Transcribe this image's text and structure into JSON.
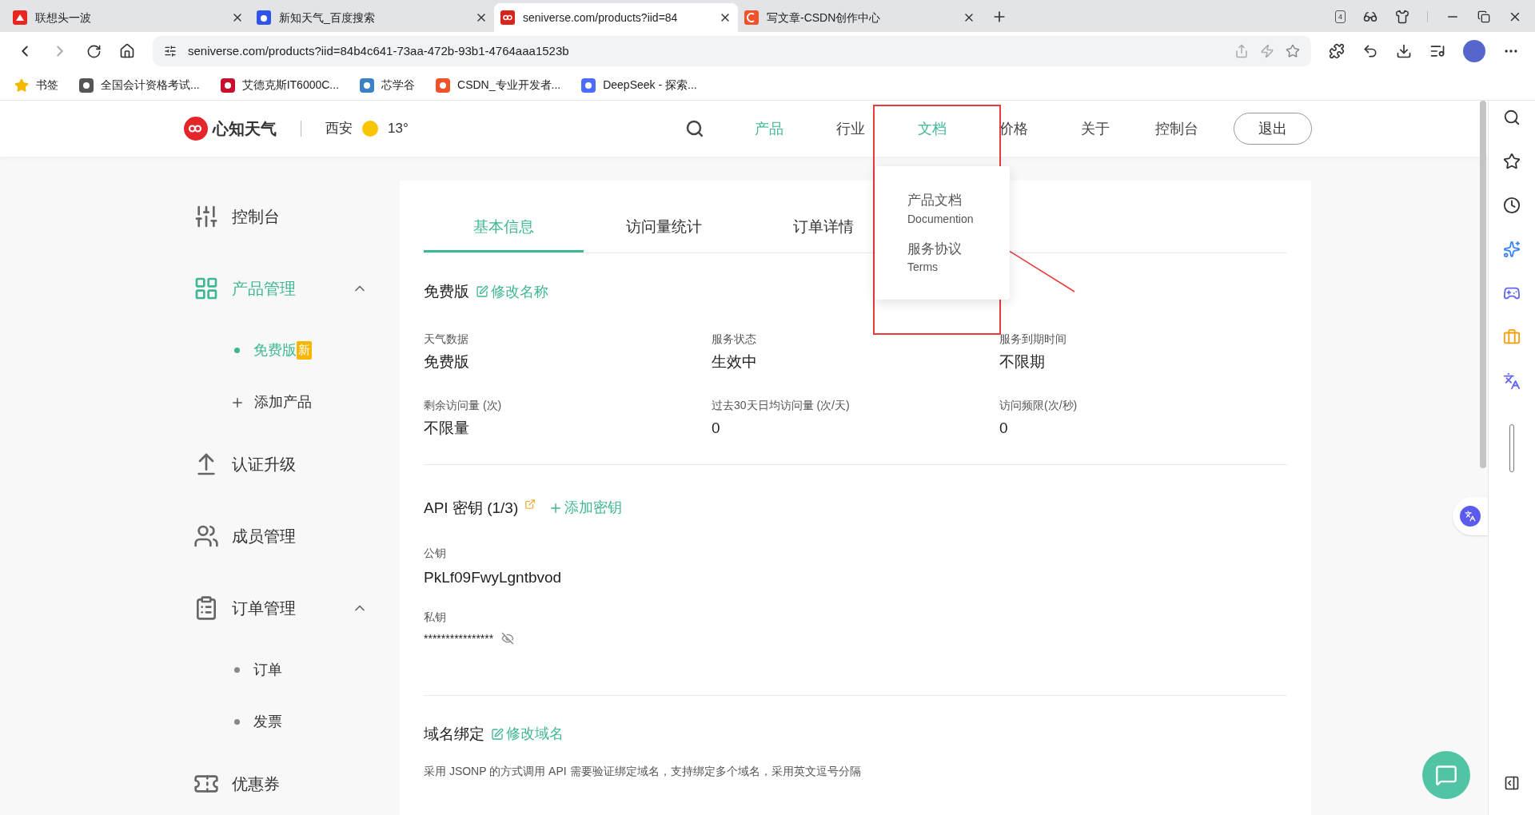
{
  "browser": {
    "tabs": [
      {
        "title": "联想头一波",
        "selected": false
      },
      {
        "title": "新知天气_百度搜索",
        "selected": false
      },
      {
        "title": "seniverse.com/products?iid=84",
        "selected": true
      },
      {
        "title": "写文章-CSDN创作中心",
        "selected": false
      }
    ],
    "tab_count": "4",
    "address": "seniverse.com/products?iid=84b4c641-73aa-472b-93b1-4764aaa1523b",
    "bookmarks": [
      "书签",
      "全国会计资格考试...",
      "艾德克斯IT6000C...",
      "芯学谷",
      "CSDN_专业开发者...",
      "DeepSeek - 探索..."
    ]
  },
  "site": {
    "logo_text": "心知天气",
    "city": "西安",
    "temperature": "13°",
    "nav": [
      {
        "label": "产品",
        "selected": true
      },
      {
        "label": "行业",
        "selected": false
      },
      {
        "label": "文档",
        "selected": true
      },
      {
        "label": "价格",
        "selected": false
      },
      {
        "label": "关于",
        "selected": false
      },
      {
        "label": "控制台",
        "selected": false
      }
    ],
    "logout": "退出",
    "dropdown": [
      {
        "title": "产品文档",
        "subtitle": "Documention"
      },
      {
        "title": "服务协议",
        "subtitle": "Terms"
      }
    ]
  },
  "sidebar": {
    "items": [
      {
        "label": "控制台",
        "selected": false
      },
      {
        "label": "产品管理",
        "selected": true,
        "expanded": true,
        "children": [
          {
            "label": "免费版",
            "kind": "bullet",
            "selected": true,
            "badge": "新"
          },
          {
            "label": "添加产品",
            "kind": "add",
            "selected": false
          }
        ]
      },
      {
        "label": "认证升级",
        "selected": false
      },
      {
        "label": "成员管理",
        "selected": false
      },
      {
        "label": "订单管理",
        "selected": false,
        "expanded": true,
        "children": [
          {
            "label": "订单",
            "kind": "bullet",
            "selected": false
          },
          {
            "label": "发票",
            "kind": "bullet",
            "selected": false
          }
        ]
      },
      {
        "label": "优惠券",
        "selected": false
      }
    ]
  },
  "content": {
    "tabs": [
      {
        "label": "基本信息",
        "selected": true
      },
      {
        "label": "访问量统计",
        "selected": false
      },
      {
        "label": "订单详情",
        "selected": false
      }
    ],
    "product": {
      "title": "免费版",
      "edit": "修改名称",
      "fields": [
        {
          "label": "天气数据",
          "value": "免费版"
        },
        {
          "label": "服务状态",
          "value": "生效中"
        },
        {
          "label": "服务到期时间",
          "value": "不限期"
        },
        {
          "label": "剩余访问量 (次)",
          "value": "不限量"
        },
        {
          "label": "过去30天日均访问量 (次/天)",
          "value": "0"
        },
        {
          "label": "访问频限(次/秒)",
          "value": "0"
        }
      ]
    },
    "api": {
      "title": "API 密钥 (1/3)",
      "add": "添加密钥",
      "public_label": "公钥",
      "public_key": "PkLf09FwyLgntbvod",
      "private_label": "私钥",
      "private_key": "****************"
    },
    "domain": {
      "title": "域名绑定",
      "edit": "修改域名",
      "note": "采用 JSONP 的方式调用 API 需要验证绑定域名，支持绑定多个域名，采用英文逗号分隔"
    }
  }
}
